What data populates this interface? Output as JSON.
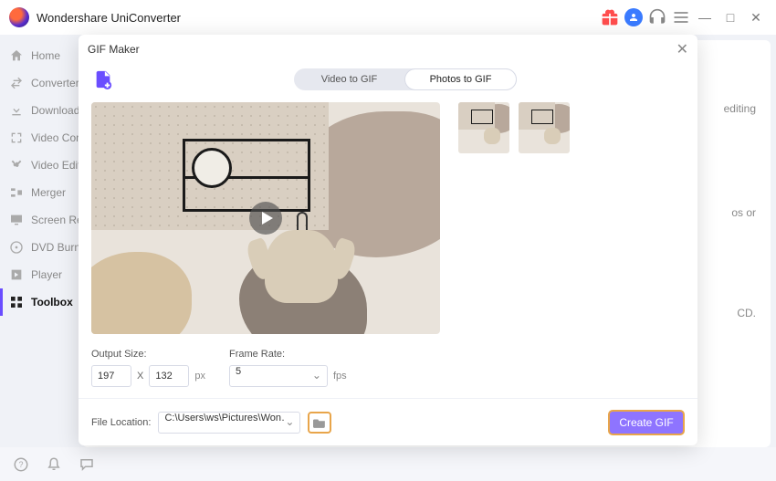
{
  "app": {
    "title": "Wondershare UniConverter"
  },
  "titlebar": {
    "min": "—",
    "max": "□",
    "close": "✕"
  },
  "sidebar": {
    "items": [
      {
        "label": "Home"
      },
      {
        "label": "Converter"
      },
      {
        "label": "Downloader"
      },
      {
        "label": "Video Compressor"
      },
      {
        "label": "Video Editor"
      },
      {
        "label": "Merger"
      },
      {
        "label": "Screen Recorder"
      },
      {
        "label": "DVD Burner"
      },
      {
        "label": "Player"
      },
      {
        "label": "Toolbox"
      }
    ]
  },
  "bg": {
    "edit": "editing",
    "videos": "os or",
    "cd": "CD."
  },
  "modal": {
    "title": "GIF Maker",
    "tabs": {
      "video": "Video to GIF",
      "photos": "Photos to GIF"
    }
  },
  "output": {
    "size_label": "Output Size:",
    "width": "197",
    "height": "132",
    "x": "X",
    "px": "px",
    "frame_label": "Frame Rate:",
    "fps_value": "5",
    "fps_unit": "fps"
  },
  "foot": {
    "loc_label": "File Location:",
    "loc_value": "C:\\Users\\ws\\Pictures\\Wondersh",
    "create": "Create GIF"
  }
}
